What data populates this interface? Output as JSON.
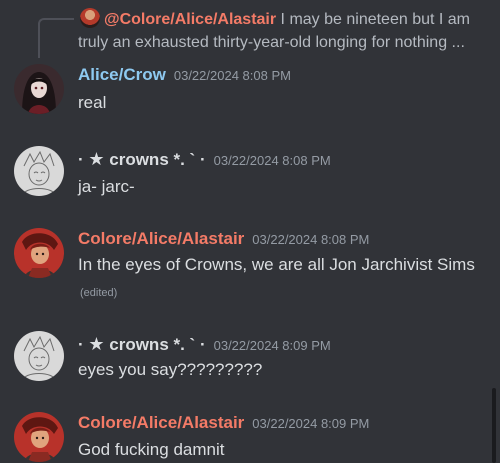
{
  "reply": {
    "author": "@Colore/Alice/Alastair",
    "text": " I may be nineteen but I am truly an exhausted thirty-year-old longing for nothing ..."
  },
  "messages": [
    {
      "author": "Alice/Crow",
      "timestamp": "03/22/2024 8:08 PM",
      "content": "real"
    },
    {
      "author_prefix": "· ",
      "author_star": "★",
      "author": " crowns *. ` ·",
      "timestamp": "03/22/2024 8:08 PM",
      "content": "ja- jarc-"
    },
    {
      "author": "Colore/Alice/Alastair",
      "timestamp": "03/22/2024 8:08 PM",
      "content": "In the eyes of Crowns, we are all Jon Jarchivist Sims",
      "edited": "(edited)"
    },
    {
      "author_prefix": "· ",
      "author_star": "★",
      "author": " crowns *. ` ·",
      "timestamp": "03/22/2024 8:09 PM",
      "content": "eyes you say?????????"
    },
    {
      "author": "Colore/Alice/Alastair",
      "timestamp": "03/22/2024 8:09 PM",
      "content": "God fucking damnit"
    }
  ],
  "colors": {
    "background": "#313338",
    "text": "#dbdee1",
    "timestamp": "#949ba4",
    "crow_name": "#8ec9f0",
    "colore_name": "#f47b67"
  }
}
